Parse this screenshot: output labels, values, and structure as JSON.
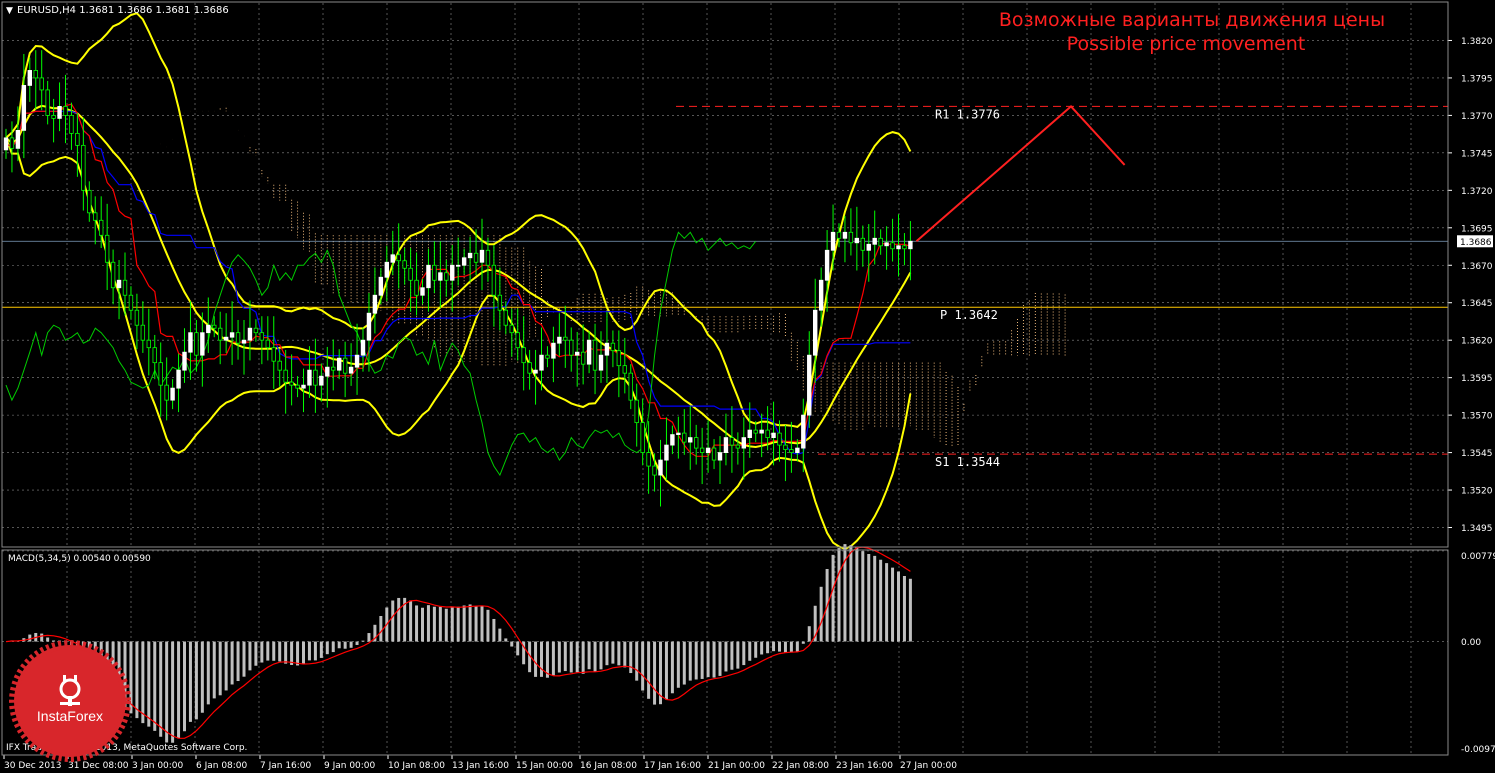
{
  "header": {
    "symbol_line": "EURUSD,H4  1.3681 1.3686 1.3681 1.3686",
    "forecast_title_ru": "Возможные варианты движения цены",
    "forecast_title_en": "Possible price movement",
    "copyright": "IFX Trader, © 2001-2013, MetaQuotes Software Corp.",
    "logo_text": "InstaForex"
  },
  "colors": {
    "background": "#000000",
    "grid": "#8a8a8a",
    "bull_candle": "#ffffff",
    "candle_wick": "#00ff00",
    "bollinger": "#ffff00",
    "kijun": "#0000ff",
    "tenkan": "#ff0000",
    "chikou": "#00cc00",
    "cloud": "#e8b478",
    "forecast": "#ff2020",
    "macd_hist": "#c0c0c0",
    "macd_signal": "#ff0000",
    "pivot": "#ffc800",
    "current_price": "#7f9fbf"
  },
  "chart_data": {
    "type": "candlestick",
    "symbol": "EURUSD",
    "timeframe": "H4",
    "ohlc_last": {
      "open": 1.3681,
      "high": 1.3686,
      "low": 1.3681,
      "close": 1.3686
    },
    "price_axis": {
      "ylim": [
        1.3482,
        1.3845
      ],
      "ticks": [
        1.382,
        1.3795,
        1.377,
        1.3745,
        1.372,
        1.3695,
        1.367,
        1.3645,
        1.362,
        1.3595,
        1.357,
        1.3545,
        1.352,
        1.3495
      ],
      "tick_labels": [
        "1.3820",
        "1.3795",
        "1.3770",
        "1.3745",
        "1.3720",
        "1.3695",
        "1.3670",
        "1.3645",
        "1.3620",
        "1.3595",
        "1.3570",
        "1.3545",
        "1.3520",
        "1.3495"
      ],
      "current_price_label": "1.3686"
    },
    "time_axis": {
      "labels": [
        "30 Dec 2013",
        "31 Dec 08:00",
        "3 Jan 00:00",
        "6 Jan 08:00",
        "7 Jan 16:00",
        "9 Jan 00:00",
        "10 Jan 08:00",
        "13 Jan 16:00",
        "15 Jan 00:00",
        "16 Jan 08:00",
        "17 Jan 16:00",
        "21 Jan 00:00",
        "22 Jan 08:00",
        "23 Jan 16:00",
        "27 Jan 00:00"
      ],
      "bars": 153,
      "future_bars": 26
    },
    "levels": [
      {
        "name": "R1",
        "label": "R1 1.3776",
        "value": 1.3776,
        "style": "dashed"
      },
      {
        "name": "P",
        "label": "P 1.3642",
        "value": 1.3642,
        "style": "solid"
      },
      {
        "name": "S1",
        "label": "S1 1.3544",
        "value": 1.3544,
        "style": "dashed"
      }
    ],
    "current_price": 1.3686,
    "forecast_path": [
      {
        "bar": 153,
        "price": 1.3686
      },
      {
        "bar": 179,
        "price": 1.3776
      },
      {
        "bar": 188,
        "price": 1.3737
      }
    ],
    "closes": [
      1.3755,
      1.3748,
      1.376,
      1.379,
      1.38,
      1.3795,
      1.3787,
      1.377,
      1.3768,
      1.3776,
      1.377,
      1.3758,
      1.375,
      1.372,
      1.3705,
      1.37,
      1.369,
      1.3672,
      1.3655,
      1.366,
      1.365,
      1.364,
      1.363,
      1.362,
      1.3615,
      1.3605,
      1.359,
      1.358,
      1.3588,
      1.36,
      1.3612,
      1.3625,
      1.361,
      1.3625,
      1.363,
      1.3628,
      1.362,
      1.3622,
      1.3625,
      1.3618,
      1.362,
      1.3628,
      1.3625,
      1.362,
      1.3615,
      1.3606,
      1.36,
      1.3592,
      1.359,
      1.3588,
      1.359,
      1.36,
      1.359,
      1.3596,
      1.3602,
      1.36,
      1.3608,
      1.3598,
      1.3602,
      1.361,
      1.362,
      1.3638,
      1.365,
      1.3662,
      1.3672,
      1.3677,
      1.3673,
      1.3668,
      1.366,
      1.365,
      1.3655,
      1.367,
      1.366,
      1.3665,
      1.366,
      1.367,
      1.367,
      1.3675,
      1.3678,
      1.3672,
      1.368,
      1.367,
      1.365,
      1.364,
      1.363,
      1.3625,
      1.3615,
      1.3605,
      1.3598,
      1.36,
      1.361,
      1.3608,
      1.3618,
      1.3622,
      1.362,
      1.361,
      1.3612,
      1.3604,
      1.362,
      1.36,
      1.361,
      1.3618,
      1.3613,
      1.3603,
      1.3598,
      1.358,
      1.3565,
      1.3545,
      1.3536,
      1.353,
      1.354,
      1.355,
      1.3557,
      1.3558,
      1.3552,
      1.3555,
      1.3548,
      1.3545,
      1.3548,
      1.354,
      1.3545,
      1.3555,
      1.355,
      1.3548,
      1.3555,
      1.356,
      1.3558,
      1.356,
      1.3555,
      1.3558,
      1.355,
      1.3547,
      1.3545,
      1.3548,
      1.357,
      1.361,
      1.364,
      1.366,
      1.368,
      1.3692,
      1.3688,
      1.3692,
      1.3685,
      1.3688,
      1.368,
      1.3684,
      1.3688,
      1.3683,
      1.3685,
      1.3681,
      1.3683,
      1.3681,
      1.3686
    ],
    "macd": {
      "label": "MACD(5,34,5) 0.00540 0.00590",
      "params": [
        5,
        34,
        5
      ],
      "main": 0.0054,
      "signal": 0.0059,
      "ylim": [
        -0.00976,
        0.00779
      ],
      "tick_labels": [
        "0.00779",
        "0.00",
        "-0.00976"
      ]
    }
  }
}
